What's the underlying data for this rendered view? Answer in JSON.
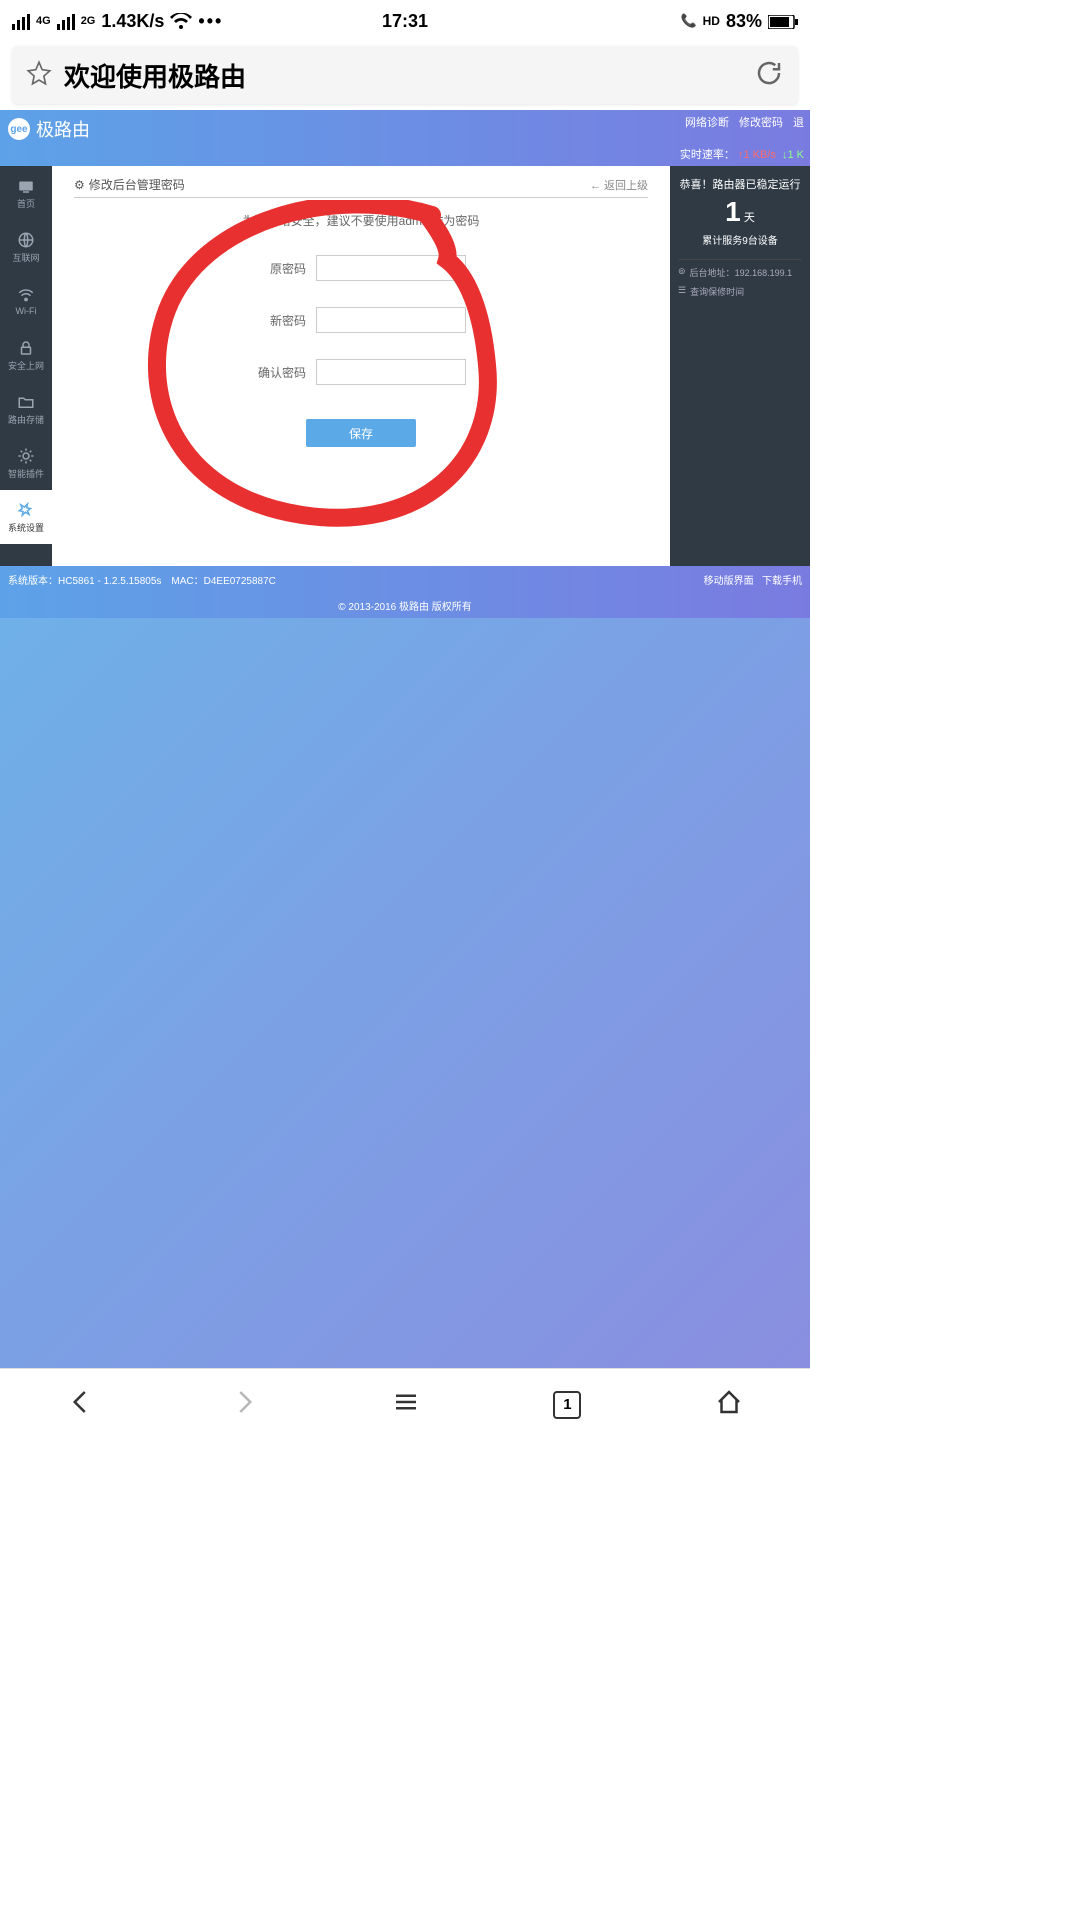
{
  "statusbar": {
    "net4g": "4G",
    "net2g": "2G",
    "speed": "1.43K/s",
    "time": "17:31",
    "hd": "HD",
    "battery": "83%"
  },
  "browser": {
    "page_title": "欢迎使用极路由",
    "tab_count": "1"
  },
  "router_header": {
    "logo_badge": "gee",
    "brand": "极路由",
    "links": {
      "diag": "网络诊断",
      "passwd": "修改密码",
      "more": "退"
    },
    "rate_label": "实时速率：",
    "rate_up": "1 KB/s",
    "rate_down": "1 K"
  },
  "sidebar": {
    "items": [
      {
        "label": "首页"
      },
      {
        "label": "互联网"
      },
      {
        "label": "Wi-Fi"
      },
      {
        "label": "安全上网"
      },
      {
        "label": "路由存储"
      },
      {
        "label": "智能插件"
      },
      {
        "label": "系统设置"
      }
    ]
  },
  "panel": {
    "title": "修改后台管理密码",
    "back": "← 返回上级",
    "hint": "为了网络安全，建议不要使用admin作为密码",
    "old_label": "原密码",
    "new_label": "新密码",
    "confirm_label": "确认密码",
    "save": "保存"
  },
  "rightcol": {
    "congrats": "恭喜！路由器已稳定运行",
    "days_num": "1",
    "days_unit": "天",
    "devices": "累计服务9台设备",
    "backend_label": "后台地址：",
    "backend_ip": "192.168.199.1",
    "warranty": "查询保修时间"
  },
  "footer": {
    "version": "系统版本：HC5861 - 1.2.5.15805s　MAC：D4EE0725887C",
    "mobile": "移动版界面",
    "download": "下载手机",
    "copyright": "© 2013-2016 极路由 版权所有"
  }
}
